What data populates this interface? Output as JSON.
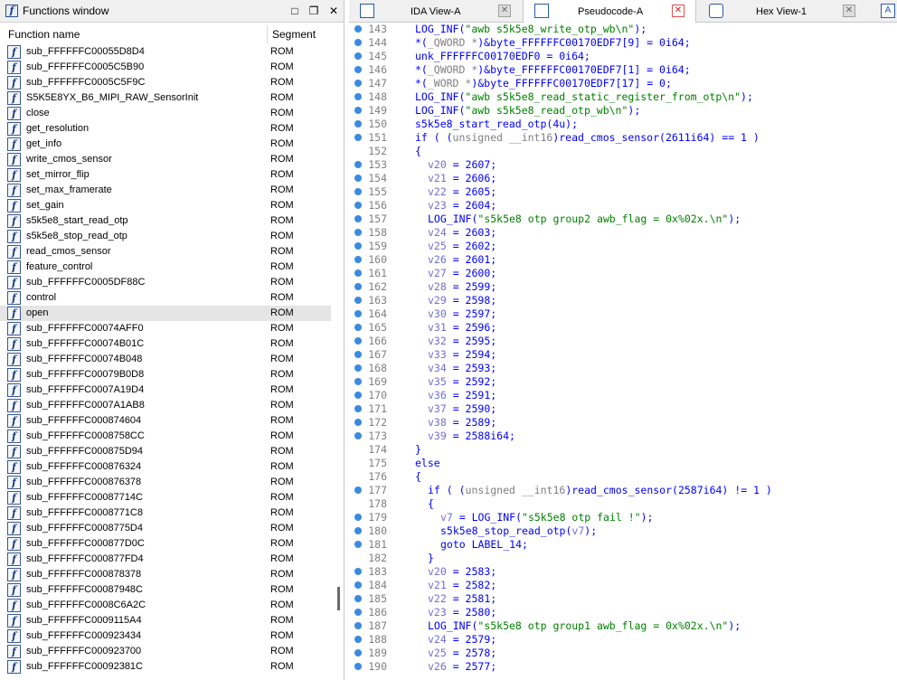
{
  "functions_window": {
    "title": "Functions window",
    "controls": [
      "□",
      "❐",
      "✕"
    ],
    "col_name": "Function name",
    "col_segment": "Segment",
    "selected_index": 17,
    "rows": [
      {
        "name": "sub_FFFFFFC00055D8D4",
        "segment": "ROM"
      },
      {
        "name": "sub_FFFFFFC0005C5B90",
        "segment": "ROM"
      },
      {
        "name": "sub_FFFFFFC0005C5F9C",
        "segment": "ROM"
      },
      {
        "name": "S5K5E8YX_B6_MIPI_RAW_SensorInit",
        "segment": "ROM"
      },
      {
        "name": "close",
        "segment": "ROM"
      },
      {
        "name": "get_resolution",
        "segment": "ROM"
      },
      {
        "name": "get_info",
        "segment": "ROM"
      },
      {
        "name": "write_cmos_sensor",
        "segment": "ROM"
      },
      {
        "name": "set_mirror_flip",
        "segment": "ROM"
      },
      {
        "name": "set_max_framerate",
        "segment": "ROM"
      },
      {
        "name": "set_gain",
        "segment": "ROM"
      },
      {
        "name": "s5k5e8_start_read_otp",
        "segment": "ROM"
      },
      {
        "name": "s5k5e8_stop_read_otp",
        "segment": "ROM"
      },
      {
        "name": "read_cmos_sensor",
        "segment": "ROM"
      },
      {
        "name": "feature_control",
        "segment": "ROM"
      },
      {
        "name": "sub_FFFFFFC0005DF88C",
        "segment": "ROM"
      },
      {
        "name": "control",
        "segment": "ROM"
      },
      {
        "name": "open",
        "segment": "ROM"
      },
      {
        "name": "sub_FFFFFFC00074AFF0",
        "segment": "ROM"
      },
      {
        "name": "sub_FFFFFFC00074B01C",
        "segment": "ROM"
      },
      {
        "name": "sub_FFFFFFC00074B048",
        "segment": "ROM"
      },
      {
        "name": "sub_FFFFFFC00079B0D8",
        "segment": "ROM"
      },
      {
        "name": "sub_FFFFFFC0007A19D4",
        "segment": "ROM"
      },
      {
        "name": "sub_FFFFFFC0007A1AB8",
        "segment": "ROM"
      },
      {
        "name": "sub_FFFFFFC000874604",
        "segment": "ROM"
      },
      {
        "name": "sub_FFFFFFC0008758CC",
        "segment": "ROM"
      },
      {
        "name": "sub_FFFFFFC000875D94",
        "segment": "ROM"
      },
      {
        "name": "sub_FFFFFFC000876324",
        "segment": "ROM"
      },
      {
        "name": "sub_FFFFFFC000876378",
        "segment": "ROM"
      },
      {
        "name": "sub_FFFFFFC00087714C",
        "segment": "ROM"
      },
      {
        "name": "sub_FFFFFFC0008771C8",
        "segment": "ROM"
      },
      {
        "name": "sub_FFFFFFC0008775D4",
        "segment": "ROM"
      },
      {
        "name": "sub_FFFFFFC000877D0C",
        "segment": "ROM"
      },
      {
        "name": "sub_FFFFFFC000877FD4",
        "segment": "ROM"
      },
      {
        "name": "sub_FFFFFFC000878378",
        "segment": "ROM"
      },
      {
        "name": "sub_FFFFFFC00087948C",
        "segment": "ROM"
      },
      {
        "name": "sub_FFFFFFC0008C6A2C",
        "segment": "ROM"
      },
      {
        "name": "sub_FFFFFFC0009115A4",
        "segment": "ROM"
      },
      {
        "name": "sub_FFFFFFC000923434",
        "segment": "ROM"
      },
      {
        "name": "sub_FFFFFFC000923700",
        "segment": "ROM"
      },
      {
        "name": "sub_FFFFFFC00092381C",
        "segment": "ROM"
      }
    ]
  },
  "tabs": [
    {
      "label": "IDA View-A",
      "active": false
    },
    {
      "label": "Pseudocode-A",
      "active": true
    },
    {
      "label": "Hex View-1",
      "active": false
    }
  ],
  "code_lines": [
    {
      "n": "143",
      "dot": true,
      "i": 0,
      "t": "LOG_INF(\"awb s5k5e8_write_otp_wb\\n\");"
    },
    {
      "n": "144",
      "dot": true,
      "i": 0,
      "t": "*(_QWORD *)&byte_FFFFFFC00170EDF7[9] = 0i64;"
    },
    {
      "n": "145",
      "dot": true,
      "i": 0,
      "t": "unk_FFFFFFC00170EDF0 = 0i64;"
    },
    {
      "n": "146",
      "dot": true,
      "i": 0,
      "t": "*(_QWORD *)&byte_FFFFFFC00170EDF7[1] = 0i64;"
    },
    {
      "n": "147",
      "dot": true,
      "i": 0,
      "t": "*(_WORD *)&byte_FFFFFFC00170EDF7[17] = 0;"
    },
    {
      "n": "148",
      "dot": true,
      "i": 0,
      "t": "LOG_INF(\"awb s5k5e8_read_static_register_from_otp\\n\");"
    },
    {
      "n": "149",
      "dot": true,
      "i": 0,
      "t": "LOG_INF(\"awb s5k5e8_read_otp_wb\\n\");"
    },
    {
      "n": "150",
      "dot": true,
      "i": 0,
      "t": "s5k5e8_start_read_otp(4u);"
    },
    {
      "n": "151",
      "dot": true,
      "i": 0,
      "t": "if ( (unsigned __int16)read_cmos_sensor(2611i64) == 1 )"
    },
    {
      "n": "152",
      "dot": false,
      "i": 0,
      "t": "{"
    },
    {
      "n": "153",
      "dot": true,
      "i": 1,
      "t": "v20 = 2607;"
    },
    {
      "n": "154",
      "dot": true,
      "i": 1,
      "t": "v21 = 2606;"
    },
    {
      "n": "155",
      "dot": true,
      "i": 1,
      "t": "v22 = 2605;"
    },
    {
      "n": "156",
      "dot": true,
      "i": 1,
      "t": "v23 = 2604;"
    },
    {
      "n": "157",
      "dot": true,
      "i": 1,
      "t": "LOG_INF(\"s5k5e8 otp group2 awb_flag = 0x%02x.\\n\");"
    },
    {
      "n": "158",
      "dot": true,
      "i": 1,
      "t": "v24 = 2603;"
    },
    {
      "n": "159",
      "dot": true,
      "i": 1,
      "t": "v25 = 2602;"
    },
    {
      "n": "160",
      "dot": true,
      "i": 1,
      "t": "v26 = 2601;"
    },
    {
      "n": "161",
      "dot": true,
      "i": 1,
      "t": "v27 = 2600;"
    },
    {
      "n": "162",
      "dot": true,
      "i": 1,
      "t": "v28 = 2599;"
    },
    {
      "n": "163",
      "dot": true,
      "i": 1,
      "t": "v29 = 2598;"
    },
    {
      "n": "164",
      "dot": true,
      "i": 1,
      "t": "v30 = 2597;"
    },
    {
      "n": "165",
      "dot": true,
      "i": 1,
      "t": "v31 = 2596;"
    },
    {
      "n": "166",
      "dot": true,
      "i": 1,
      "t": "v32 = 2595;"
    },
    {
      "n": "167",
      "dot": true,
      "i": 1,
      "t": "v33 = 2594;"
    },
    {
      "n": "168",
      "dot": true,
      "i": 1,
      "t": "v34 = 2593;"
    },
    {
      "n": "169",
      "dot": true,
      "i": 1,
      "t": "v35 = 2592;"
    },
    {
      "n": "170",
      "dot": true,
      "i": 1,
      "t": "v36 = 2591;"
    },
    {
      "n": "171",
      "dot": true,
      "i": 1,
      "t": "v37 = 2590;"
    },
    {
      "n": "172",
      "dot": true,
      "i": 1,
      "t": "v38 = 2589;"
    },
    {
      "n": "173",
      "dot": true,
      "i": 1,
      "t": "v39 = 2588i64;"
    },
    {
      "n": "174",
      "dot": false,
      "i": 0,
      "t": "}"
    },
    {
      "n": "175",
      "dot": false,
      "i": 0,
      "t": "else"
    },
    {
      "n": "176",
      "dot": false,
      "i": 0,
      "t": "{"
    },
    {
      "n": "177",
      "dot": true,
      "i": 1,
      "t": "if ( (unsigned __int16)read_cmos_sensor(2587i64) != 1 )"
    },
    {
      "n": "178",
      "dot": false,
      "i": 1,
      "t": "{"
    },
    {
      "n": "179",
      "dot": true,
      "i": 2,
      "t": "v7 = LOG_INF(\"s5k5e8 otp fail !\");"
    },
    {
      "n": "180",
      "dot": true,
      "i": 2,
      "t": "s5k5e8_stop_read_otp(v7);"
    },
    {
      "n": "181",
      "dot": true,
      "i": 2,
      "t": "goto LABEL_14;"
    },
    {
      "n": "182",
      "dot": false,
      "i": 1,
      "t": "}"
    },
    {
      "n": "183",
      "dot": true,
      "i": 1,
      "t": "v20 = 2583;"
    },
    {
      "n": "184",
      "dot": true,
      "i": 1,
      "t": "v21 = 2582;"
    },
    {
      "n": "185",
      "dot": true,
      "i": 1,
      "t": "v22 = 2581;"
    },
    {
      "n": "186",
      "dot": true,
      "i": 1,
      "t": "v23 = 2580;"
    },
    {
      "n": "187",
      "dot": true,
      "i": 1,
      "t": "LOG_INF(\"s5k5e8 otp group1 awb_flag = 0x%02x.\\n\");"
    },
    {
      "n": "188",
      "dot": true,
      "i": 1,
      "t": "v24 = 2579;"
    },
    {
      "n": "189",
      "dot": true,
      "i": 1,
      "t": "v25 = 2578;"
    },
    {
      "n": "190",
      "dot": true,
      "i": 1,
      "t": "v26 = 2577;"
    }
  ]
}
